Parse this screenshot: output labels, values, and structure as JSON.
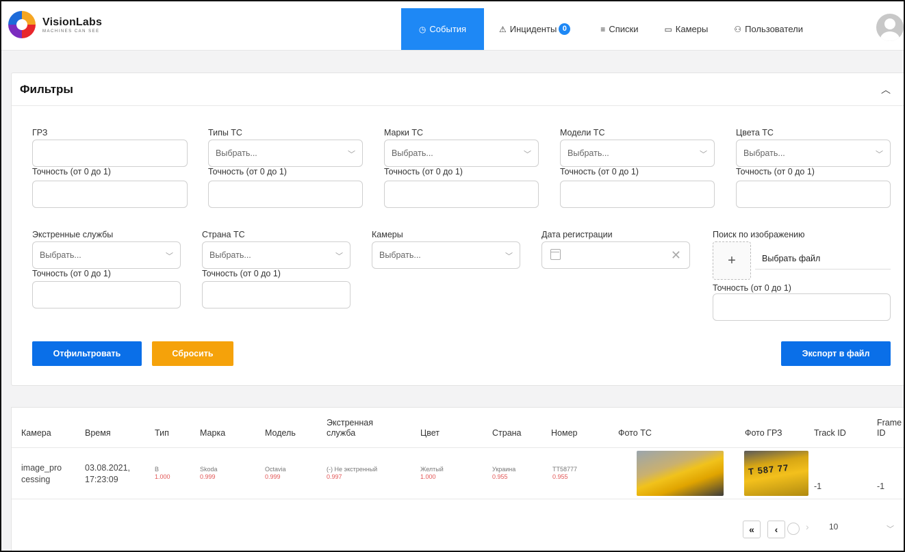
{
  "brand": {
    "title": "VisionLabs",
    "tagline": "MACHINES CAN SEE"
  },
  "nav": [
    {
      "label": "События",
      "icon": "clock-icon",
      "active": true
    },
    {
      "label": "Инциденты",
      "icon": "warning-icon",
      "badge": "0"
    },
    {
      "label": "Списки",
      "icon": "list-icon"
    },
    {
      "label": "Камеры",
      "icon": "camera-icon"
    },
    {
      "label": "Пользователи",
      "icon": "users-icon"
    }
  ],
  "filters": {
    "title": "Фильтры",
    "select_placeholder": "Выбрать...",
    "accuracy_label": "Точность (от 0 до 1)",
    "fields": {
      "grz": "ГРЗ",
      "vehicle_types": "Типы ТС",
      "brands": "Марки ТС",
      "models": "Модели ТС",
      "colors": "Цвета ТС",
      "emergency": "Экстренные службы",
      "country": "Страна ТС",
      "cameras": "Камеры",
      "reg_date": "Дата регистрации",
      "image_search": "Поиск по изображению"
    },
    "choose_file": "Выбрать файл",
    "buttons": {
      "filter": "Отфильтровать",
      "reset": "Сбросить",
      "export": "Экспорт в файл"
    }
  },
  "table": {
    "headers": {
      "camera": "Камера",
      "time": "Время",
      "type": "Тип",
      "brand": "Марка",
      "model": "Модель",
      "emergency_1": "Экстренная",
      "emergency_2": "служба",
      "color": "Цвет",
      "country": "Страна",
      "number": "Номер",
      "photo_vehicle": "Фото ТС",
      "photo_plate": "Фото ГРЗ",
      "track_id": "Track ID",
      "frame_1": "Frame",
      "frame_2": "ID"
    },
    "row": {
      "camera_1": "image_pro",
      "camera_2": "cessing",
      "date": "03.08.2021,",
      "time": "17:23:09",
      "type": "B",
      "type_conf": "1.000",
      "brand": "Skoda",
      "brand_conf": "0.999",
      "model": "Octavia",
      "model_conf": "0.999",
      "emergency": "(-) Не экстренный",
      "emergency_conf": "0.997",
      "color": "Желтый",
      "color_conf": "1.000",
      "country": "Украина",
      "country_conf": "0.955",
      "number": "TT58777",
      "number_conf": "0.955",
      "plate_text": "T 587 77",
      "track_id": "-1",
      "frame_id": "-1"
    }
  },
  "pagination": {
    "page_size": "10"
  }
}
